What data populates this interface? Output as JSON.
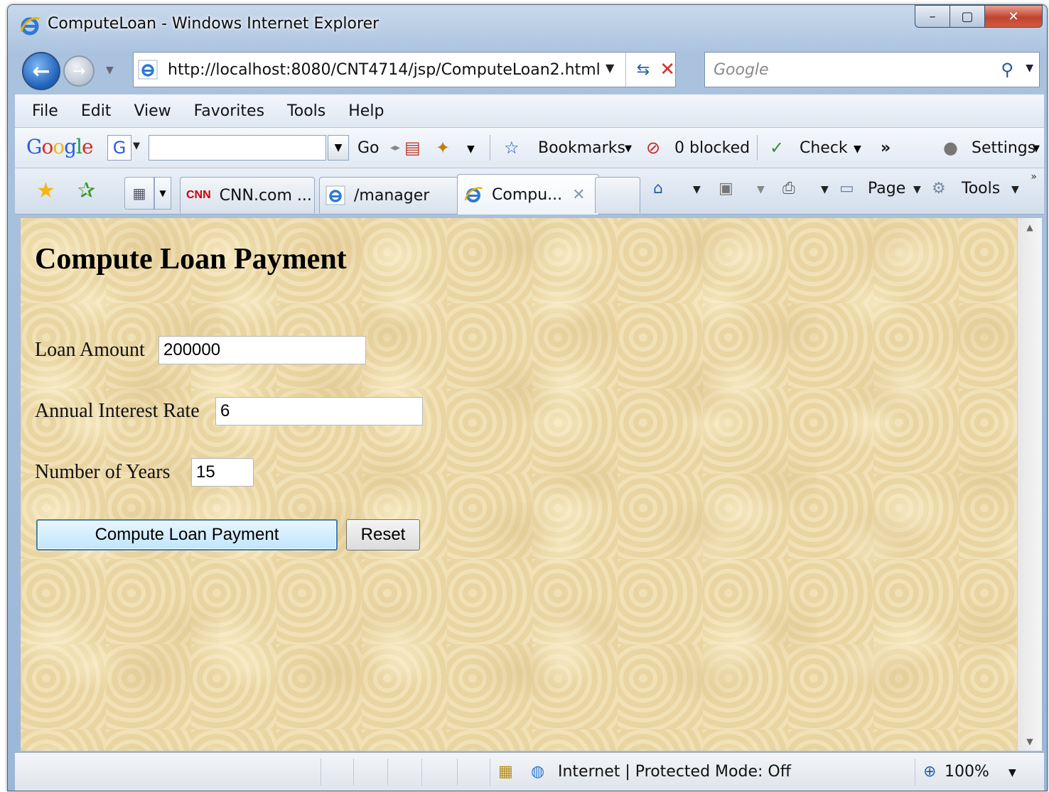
{
  "window": {
    "title": "ComputeLoan - Windows Internet Explorer",
    "minimize": "–",
    "maximize": "▢",
    "close": "✕"
  },
  "address": {
    "url": "http://localhost:8080/CNT4714/jsp/ComputeLoan2.html",
    "search_placeholder": "Google"
  },
  "menu": [
    "File",
    "Edit",
    "View",
    "Favorites",
    "Tools",
    "Help"
  ],
  "google_toolbar": {
    "logo": "Google",
    "go": "Go",
    "bookmarks": "Bookmarks",
    "blocked": "0 blocked",
    "check": "Check",
    "more": "»",
    "settings": "Settings"
  },
  "tabs": [
    {
      "label": "CNN.com ...",
      "icon": "cnn-icon",
      "logo": "CNN"
    },
    {
      "label": "/manager",
      "icon": "ie-icon"
    },
    {
      "label": "Compu...",
      "icon": "ie-icon",
      "active": true
    }
  ],
  "commands": {
    "page": "Page",
    "tools": "Tools",
    "more": "»"
  },
  "page": {
    "title": "Compute Loan Payment",
    "fields": [
      {
        "label": "Loan Amount",
        "value": "200000"
      },
      {
        "label": "Annual Interest Rate",
        "value": "6"
      },
      {
        "label": "Number of Years",
        "value": "15"
      }
    ],
    "submit_label": "Compute Loan Payment",
    "reset_label": "Reset"
  },
  "status": {
    "zone": "Internet | Protected Mode: Off",
    "zoom": "100%"
  },
  "colors": {
    "page_background": "#ecd9a8",
    "link_blue": "#2a5bd7"
  }
}
